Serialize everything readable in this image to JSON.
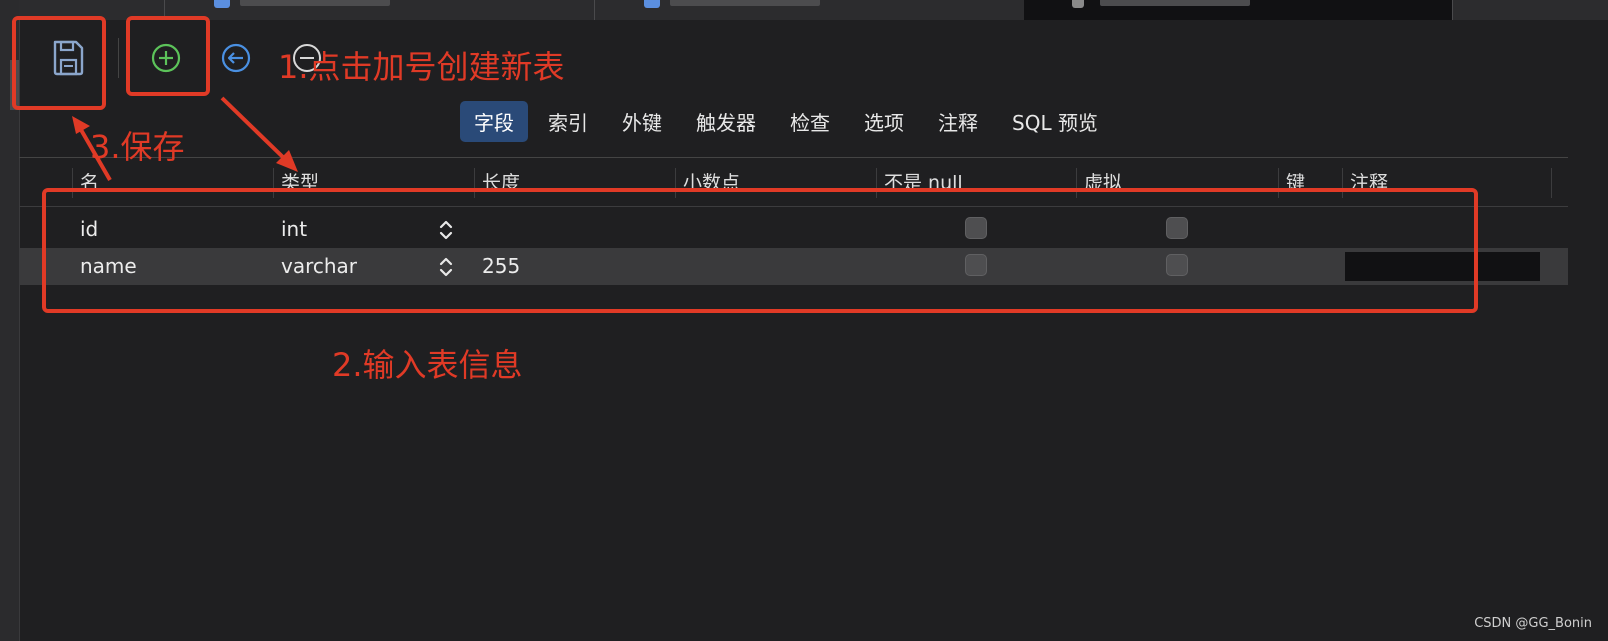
{
  "toolbar": {
    "save_icon": "floppy-disk-icon",
    "add_icon": "plus-circle-icon",
    "back_icon": "arrow-left-circle-icon",
    "add_color": "#5cc35a",
    "back_color": "#4a90e2"
  },
  "subtabs": [
    {
      "label": "字段",
      "active": true
    },
    {
      "label": "索引"
    },
    {
      "label": "外键"
    },
    {
      "label": "触发器"
    },
    {
      "label": "检查"
    },
    {
      "label": "选项"
    },
    {
      "label": "注释"
    },
    {
      "label": "SQL 预览"
    }
  ],
  "columns": [
    "名",
    "类型",
    "长度",
    "小数点",
    "不是 null",
    "虚拟",
    "键",
    "注释"
  ],
  "rows": [
    {
      "name": "id",
      "type": "int",
      "length": "",
      "decimals": "",
      "not_null": false,
      "virtual": false,
      "key": "",
      "comment": ""
    },
    {
      "name": "name",
      "type": "varchar",
      "length": "255",
      "decimals": "",
      "not_null": false,
      "virtual": false,
      "key": "",
      "comment": ""
    }
  ],
  "annotations": {
    "step1": "1.点击加号创建新表",
    "step2": "2.输入表信息",
    "step3": "3.保存",
    "color": "#e03a26"
  },
  "watermark": "CSDN @GG_Bonin"
}
